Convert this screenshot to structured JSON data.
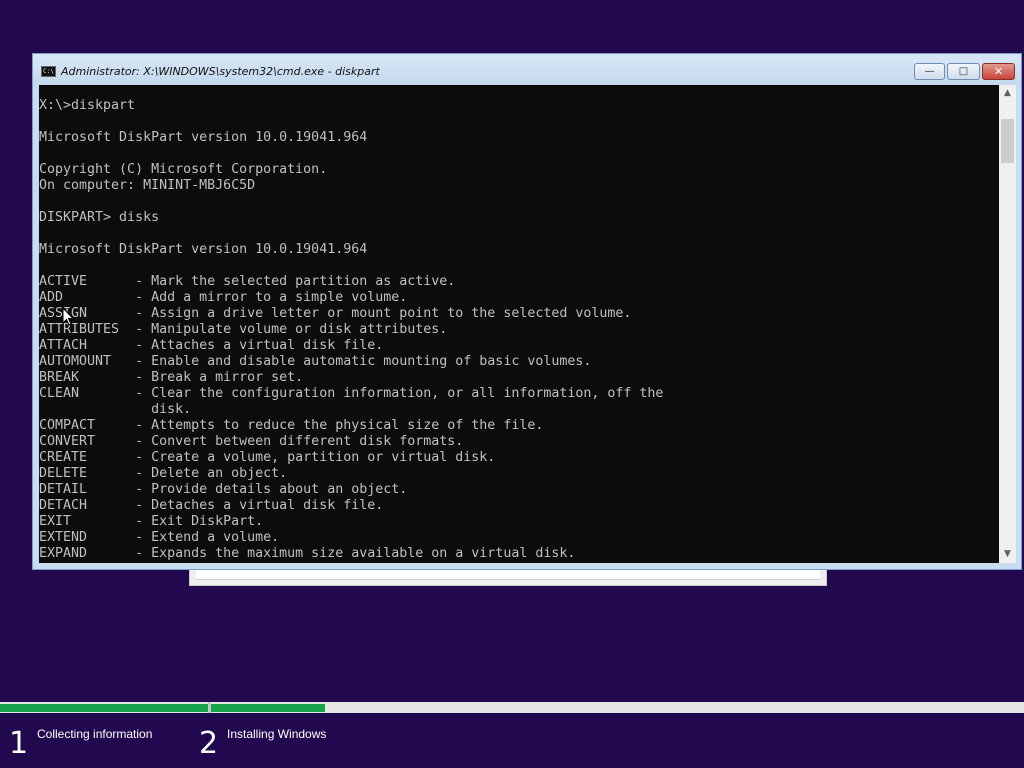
{
  "window": {
    "title": "Administrator: X:\\WINDOWS\\system32\\cmd.exe - diskpart",
    "controls": {
      "minimize": "—",
      "maximize": "□",
      "close": "✕"
    }
  },
  "console": {
    "lines": [
      "X:\\>diskpart",
      "",
      "Microsoft DiskPart version 10.0.19041.964",
      "",
      "Copyright (C) Microsoft Corporation.",
      "On computer: MININT-MBJ6C5D",
      "",
      "DISKPART> disks",
      "",
      "Microsoft DiskPart version 10.0.19041.964",
      "",
      "ACTIVE      - Mark the selected partition as active.",
      "ADD         - Add a mirror to a simple volume.",
      "ASSIGN      - Assign a drive letter or mount point to the selected volume.",
      "ATTRIBUTES  - Manipulate volume or disk attributes.",
      "ATTACH      - Attaches a virtual disk file.",
      "AUTOMOUNT   - Enable and disable automatic mounting of basic volumes.",
      "BREAK       - Break a mirror set.",
      "CLEAN       - Clear the configuration information, or all information, off the",
      "              disk.",
      "COMPACT     - Attempts to reduce the physical size of the file.",
      "CONVERT     - Convert between different disk formats.",
      "CREATE      - Create a volume, partition or virtual disk.",
      "DELETE      - Delete an object.",
      "DETAIL      - Provide details about an object.",
      "DETACH      - Detaches a virtual disk file.",
      "EXIT        - Exit DiskPart.",
      "EXTEND      - Extend a volume.",
      "EXPAND      - Expands the maximum size available on a virtual disk."
    ]
  },
  "scrollbar": {
    "up_icon": "▲",
    "down_icon": "▼"
  },
  "setup": {
    "progress": {
      "step1_fraction": 1.0,
      "step2_fraction": 0.14
    },
    "steps": [
      {
        "number": "1",
        "label": "Collecting information"
      },
      {
        "number": "2",
        "label": "Installing Windows"
      }
    ]
  },
  "colors": {
    "background": "#22094f",
    "console_bg": "#0c0c0c",
    "console_fg": "#c0c0c0",
    "progress_green": "#16a34a"
  }
}
